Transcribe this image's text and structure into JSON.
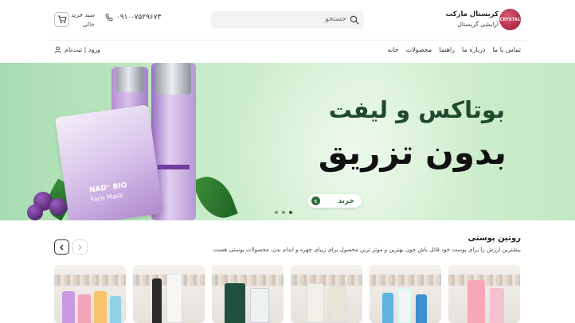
{
  "header": {
    "brand_name": "کریستال مارکت",
    "brand_subtitle": "آرایشی گریستال",
    "logo_text": "CRYSTAL",
    "search_placeholder": "جستجو",
    "phone": "۰۹۱۰-۷۵۲۹۶۷۳",
    "cart_label": "سبد خرید",
    "cart_status": "خالی"
  },
  "nav": {
    "items": [
      "خانه",
      "محصولات",
      "راهنما",
      "درباره ما",
      "تماس با ما"
    ],
    "login": "ورود | ثبت‌نام"
  },
  "banner": {
    "headline_line1": "بوتاکس و لیفت",
    "headline_line2": "بدون تزریق",
    "buy_button": "خرید",
    "product_texts": [
      "NAD⁺ BIO",
      "Face Mask"
    ],
    "colors": {
      "accent": "#2d6b3a",
      "background": "#c6ebc8"
    }
  },
  "section": {
    "title": "روتین پوستی",
    "description": "بیشترین ارزش را برای پوست خود قائل باش چون بهترین و موثر ترین محصول برای زیبای چهره و اندام بدن، محصولات پوستی هست."
  },
  "icons": [
    "search-icon",
    "phone-icon",
    "cart-icon",
    "user-icon",
    "arrow-right-icon",
    "chevron-left-icon",
    "chevron-right-icon"
  ]
}
